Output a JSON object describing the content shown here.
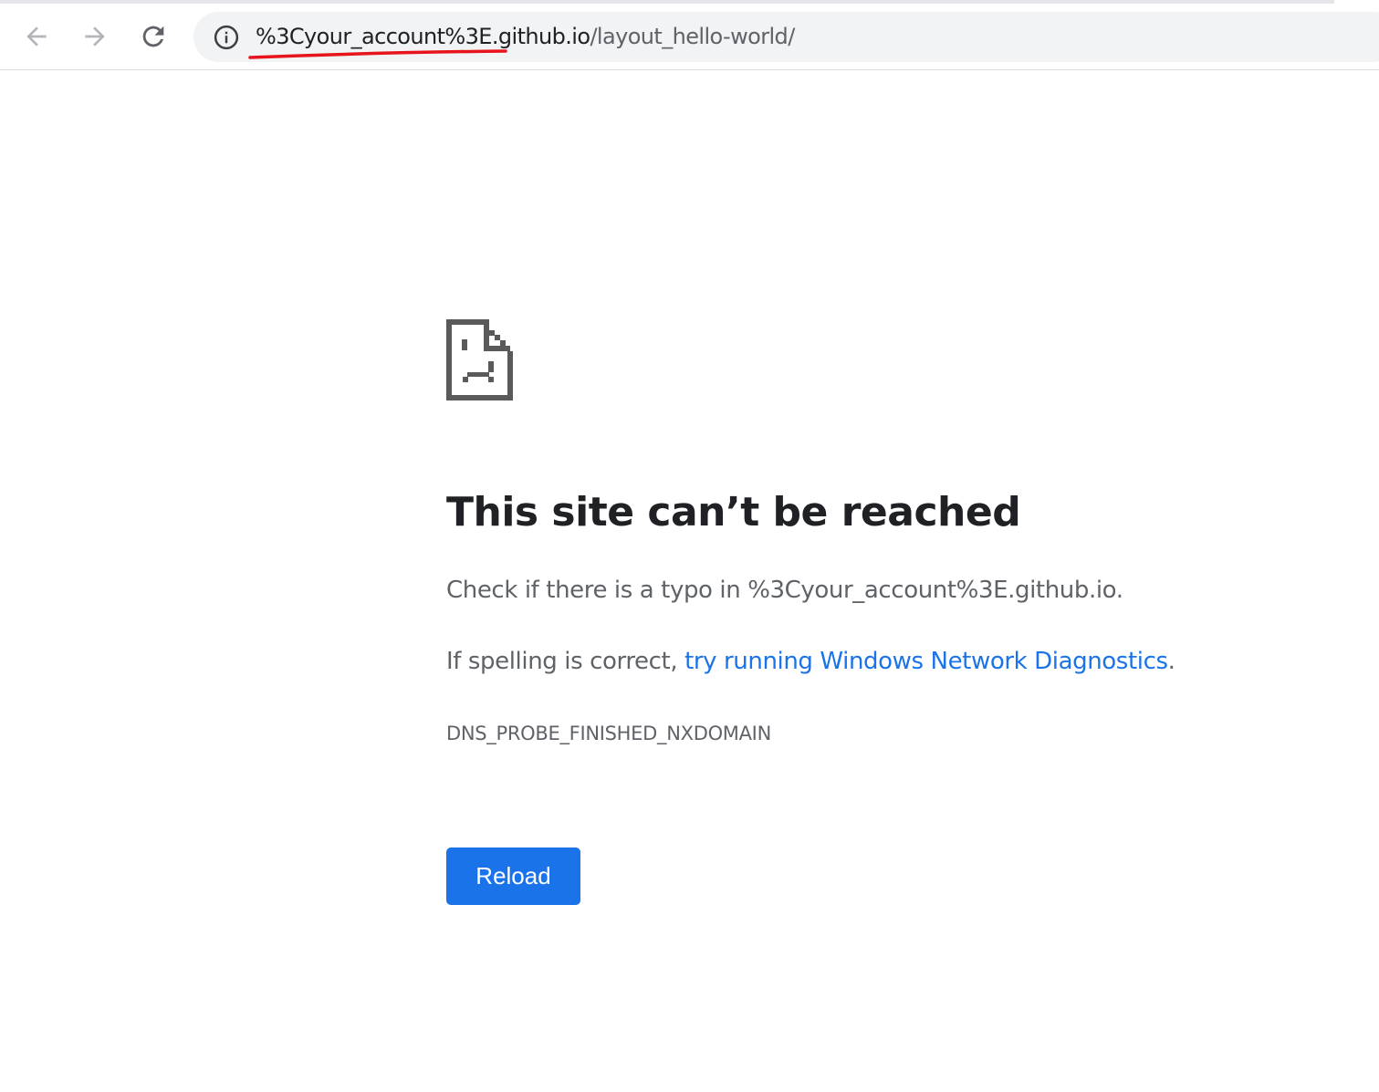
{
  "browser": {
    "url_host": "%3Cyour_account%3E.github.io",
    "url_path": "/layout_hello-world/",
    "icons": {
      "back": "arrow-left-icon",
      "forward": "arrow-right-icon",
      "reload": "reload-icon",
      "site_info": "info-icon"
    }
  },
  "error_page": {
    "icon": "sad-page-icon",
    "heading": "This site can’t be reached",
    "check_prefix": "Check if there is a typo in ",
    "check_host": "%3Cyour_account%3E.github.io",
    "check_suffix": ".",
    "spelling_prefix": "If spelling is correct, ",
    "diagnostics_link": "try running Windows Network Diagnostics",
    "spelling_suffix": ".",
    "error_code": "DNS_PROBE_FINISHED_NXDOMAIN",
    "reload_label": "Reload"
  },
  "colors": {
    "link": "#1a73e8",
    "button": "#1a73e8",
    "annotation": "#e8141c",
    "icon": "#5f6368"
  }
}
